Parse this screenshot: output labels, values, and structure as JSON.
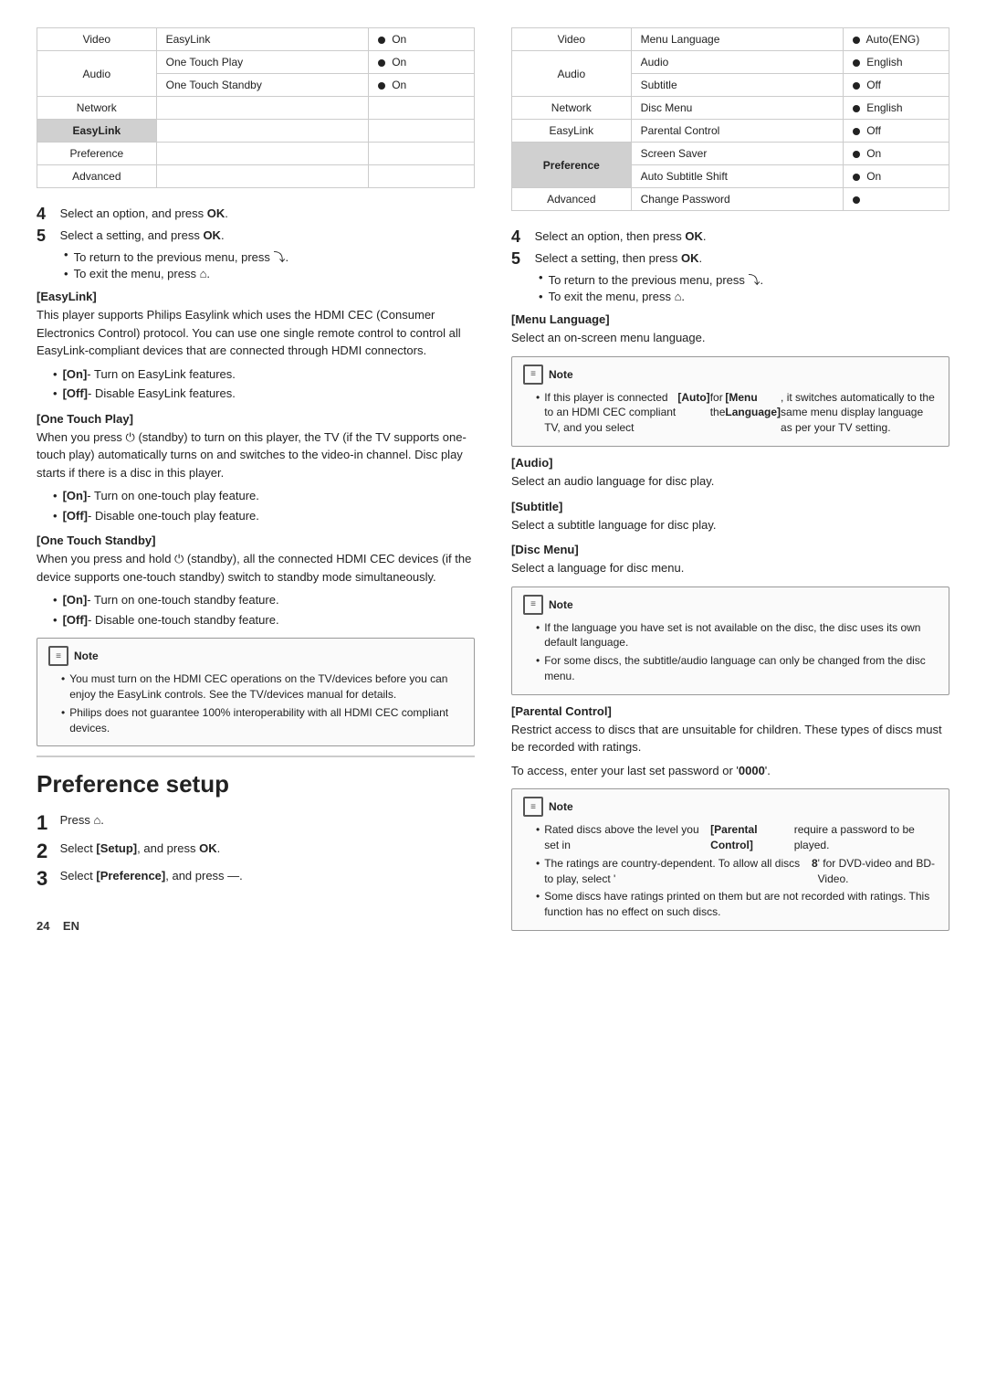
{
  "left_table": {
    "rows": [
      {
        "cat": "Video",
        "item": "EasyLink",
        "value": "On",
        "cat_rowspan": 1
      },
      {
        "cat": "Audio",
        "item": "One Touch Play",
        "value": "On",
        "cat_rowspan": 1
      },
      {
        "cat": null,
        "item": "One Touch Standby",
        "value": "On"
      },
      {
        "cat": "Network",
        "item": "",
        "value": ""
      },
      {
        "cat": "EasyLink",
        "item": "",
        "value": "",
        "highlighted": true
      },
      {
        "cat": "Preference",
        "item": "",
        "value": ""
      },
      {
        "cat": "Advanced",
        "item": "",
        "value": ""
      }
    ]
  },
  "right_table": {
    "rows": [
      {
        "cat": "Video",
        "item": "Menu Language",
        "value": "Auto(ENG)",
        "cat_rowspan": 1
      },
      {
        "cat": "Audio",
        "item": "Audio",
        "value": "English"
      },
      {
        "cat": null,
        "item": "Subtitle",
        "value": "Off"
      },
      {
        "cat": "Network",
        "item": "Disc Menu",
        "value": "English"
      },
      {
        "cat": "EasyLink",
        "item": "Parental Control",
        "value": "Off"
      },
      {
        "cat": "Preference",
        "item": "Screen Saver",
        "value": "On",
        "highlighted": true
      },
      {
        "cat": null,
        "item": "Auto Subtitle Shift",
        "value": "On",
        "highlighted": true
      },
      {
        "cat": "Advanced",
        "item": "Change Password",
        "value": "dot"
      }
    ]
  },
  "left_steps": {
    "step4": "Select an option, and press",
    "step4_bold": "OK",
    "step5": "Select a setting, and press",
    "step5_bold": "OK",
    "bullet1": "To return to the previous menu, press",
    "bullet1_sym": "↩",
    "bullet2": "To exit the menu, press",
    "bullet2_sym": "⌂"
  },
  "easylink_section": {
    "header": "[EasyLink]",
    "body": "This player supports Philips Easylink which uses the HDMI CEC (Consumer Electronics Control) protocol. You can use one single remote control to control all EasyLink-compliant devices that are connected through HDMI connectors.",
    "bullets": [
      "[On] - Turn on EasyLink features.",
      "[Off] - Disable EasyLink features."
    ]
  },
  "one_touch_play_section": {
    "header": "[One Touch Play]",
    "body": "When you press ⏻ (standby) to turn on this player, the TV (if the TV supports one-touch play) automatically turns on and switches to the video-in channel. Disc play starts if there is a disc in this player.",
    "bullets": [
      "[On] - Turn on one-touch play feature.",
      "[Off] - Disable one-touch play feature."
    ]
  },
  "one_touch_standby_section": {
    "header": "[One Touch Standby]",
    "body": "When you press and hold ⏻ (standby), all the connected HDMI CEC devices (if the device supports one-touch standby) switch to standby mode simultaneously.",
    "bullets": [
      "[On] - Turn on one-touch standby feature.",
      "[Off] - Disable one-touch standby feature."
    ]
  },
  "left_note": {
    "label": "Note",
    "bullets": [
      "You must turn on the HDMI CEC operations on the TV/devices before you can enjoy the EasyLink controls. See the TV/devices manual for details.",
      "Philips does not guarantee 100% interoperability with all HDMI CEC compliant devices."
    ]
  },
  "preference_section": {
    "title": "Preference setup",
    "step1": "Press",
    "step1_sym": "⌂",
    "step2": "Select [Setup], and press",
    "step2_bold": "OK",
    "step3": "Select [Preference], and press",
    "step3_sym": "—"
  },
  "right_steps": {
    "step4": "Select an option, then press",
    "step4_bold": "OK",
    "step5": "Select a setting, then press",
    "step5_bold": "OK",
    "bullet1": "To return to the previous menu, press",
    "bullet1_sym": "↩",
    "bullet2": "To exit the menu, press",
    "bullet2_sym": "⌂"
  },
  "menu_language_section": {
    "header": "[Menu Language]",
    "body": "Select an on-screen menu language."
  },
  "right_note1": {
    "label": "Note",
    "bullets": [
      "If this player is connected to an HDMI CEC compliant TV, and you select [Auto] for the [Menu Language], it switches automatically to the same menu display language as per your TV setting."
    ]
  },
  "audio_section": {
    "header": "[Audio]",
    "body": "Select an audio language for disc play."
  },
  "subtitle_section": {
    "header": "[Subtitle]",
    "body": "Select a subtitle language for disc play."
  },
  "disc_menu_section": {
    "header": "[Disc Menu]",
    "body": "Select a language for disc menu."
  },
  "right_note2": {
    "label": "Note",
    "bullets": [
      "If the language you have set is not available on the disc, the disc uses its own default language.",
      "For some discs, the subtitle/audio language can only be changed from the disc menu."
    ]
  },
  "parental_control_section": {
    "header": "[Parental Control]",
    "body": "Restrict access to discs that are unsuitable for children. These types of discs must be recorded with ratings.",
    "body2": "To access, enter your last set password or '0000'."
  },
  "right_note3": {
    "label": "Note",
    "bullets": [
      "Rated discs above the level you set in [Parental Control] require a password to be played.",
      "The ratings are country-dependent. To allow all discs to play, select '8' for DVD-video and BD-Video.",
      "Some discs have ratings printed on them but are not recorded with ratings. This function has no effect on such discs."
    ]
  },
  "footer": {
    "page": "24",
    "lang": "EN"
  }
}
